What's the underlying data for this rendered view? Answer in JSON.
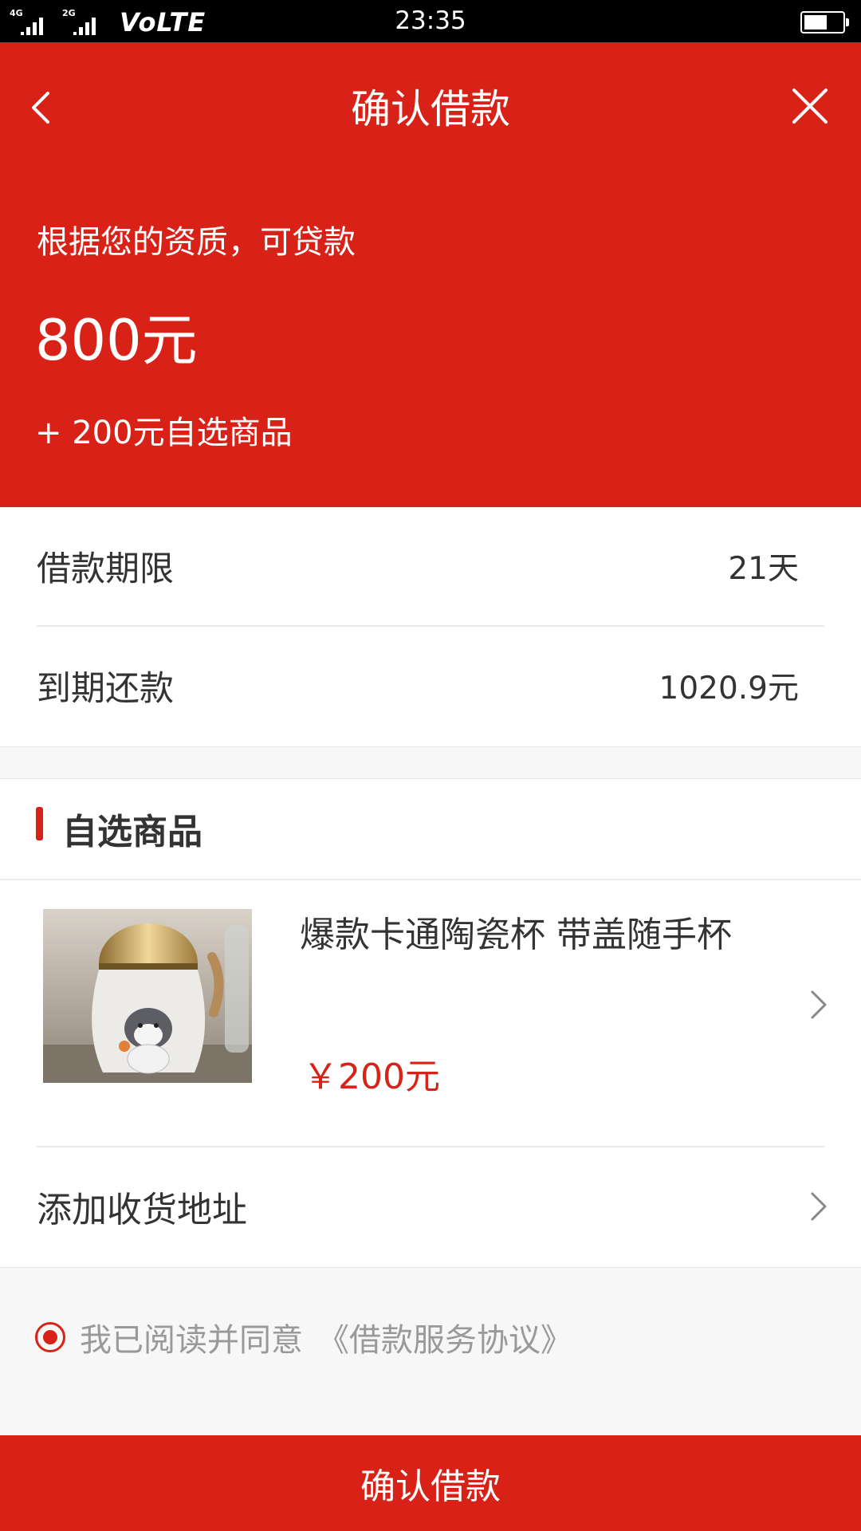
{
  "status_bar": {
    "sig1_label": "4G",
    "sig2_label": "2G",
    "volte": "VoLTE",
    "time": "23:35"
  },
  "header": {
    "title": "确认借款",
    "back_icon": "chevron-left-icon",
    "close_icon": "close-icon",
    "loan_desc": "根据您的资质，可贷款",
    "loan_amount": "800元",
    "loan_extra": "+ 200元自选商品"
  },
  "info": {
    "term_label": "借款期限",
    "term_value": "21天",
    "due_label": "到期还款",
    "due_value": "1020.9元"
  },
  "goods": {
    "section_title": "自选商品",
    "product_name": "爆款卡通陶瓷杯 带盖随手杯",
    "product_price": "￥200元",
    "address_label": "添加收货地址"
  },
  "agreement": {
    "text": "我已阅读并同意",
    "link": "《借款服务协议》",
    "checked": true
  },
  "confirm_button": "确认借款",
  "colors": {
    "brand_red": "#d92217",
    "text_dark": "#333333",
    "text_muted": "#999999"
  }
}
